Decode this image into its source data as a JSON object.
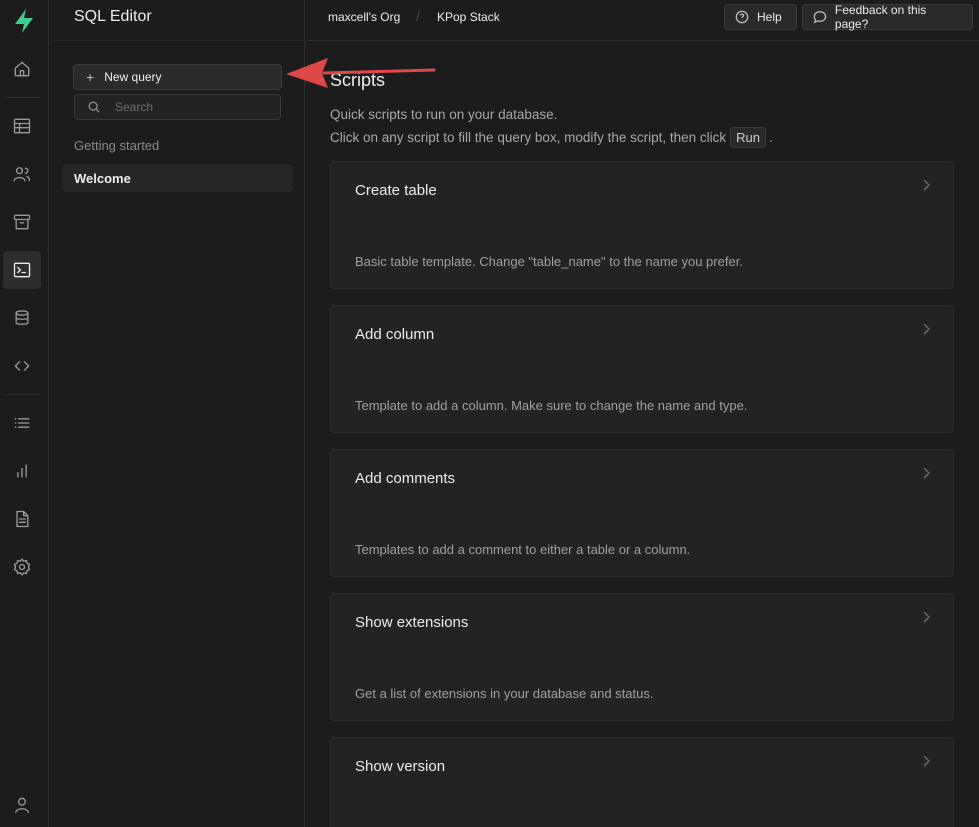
{
  "app": {
    "section_title": "SQL Editor"
  },
  "breadcrumb": {
    "org": "maxcell's Org",
    "project": "KPop Stack"
  },
  "header": {
    "help_label": "Help",
    "feedback_label": "Feedback on this page?"
  },
  "sidebar": {
    "new_query_label": "New query",
    "search_placeholder": "Search",
    "section_label": "Getting started",
    "items": [
      {
        "label": "Welcome",
        "active": true
      }
    ]
  },
  "rail": {
    "icons": [
      "home-icon",
      "table-editor-icon",
      "auth-users-icon",
      "storage-icon",
      "sql-editor-icon",
      "database-icon",
      "api-code-icon",
      "logs-list-icon",
      "reports-icon",
      "docs-icon",
      "settings-icon",
      "account-icon"
    ],
    "active": "sql-editor-icon"
  },
  "main": {
    "heading": "Scripts",
    "description_line1": "Quick scripts to run on your database.",
    "description_line2_before": "Click on any script to fill the query box, modify the script, then click",
    "run_key": "Run",
    "description_line2_after": ".",
    "scripts": [
      {
        "title": "Create table",
        "description": "Basic table template. Change \"table_name\" to the name you prefer."
      },
      {
        "title": "Add column",
        "description": "Template to add a column. Make sure to change the name and type."
      },
      {
        "title": "Add comments",
        "description": "Templates to add a comment to either a table or a column."
      },
      {
        "title": "Show extensions",
        "description": "Get a list of extensions in your database and status."
      },
      {
        "title": "Show version",
        "description": ""
      }
    ]
  },
  "colors": {
    "brand": "#3ecf8e",
    "annotation_arrow": "#e04848",
    "background": "#1c1c1c"
  }
}
